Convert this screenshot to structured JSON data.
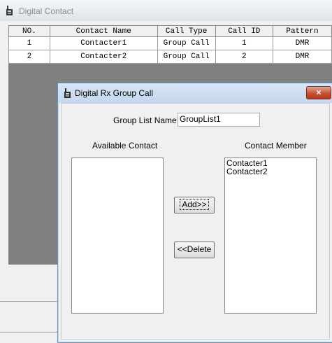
{
  "background_window": {
    "title": "Digital Contact",
    "icon": "radio-icon",
    "table": {
      "columns": [
        "NO.",
        "Contact Name",
        "Call Type",
        "Call ID",
        "Pattern"
      ],
      "rows": [
        [
          "1",
          "Contacter1",
          "Group Call",
          "1",
          "DMR"
        ],
        [
          "2",
          "Contacter2",
          "Group Call",
          "2",
          "DMR"
        ]
      ]
    }
  },
  "dialog": {
    "title": "Digital Rx Group Call",
    "icon": "radio-icon",
    "close_label": "×",
    "group_list_name_label": "Group List Name",
    "group_list_name_value": "GroupList1",
    "available_contact_label": "Available Contact",
    "available_contact_items": [],
    "contact_member_label": "Contact Member",
    "contact_member_items": [
      "Contacter1",
      "Contacter2"
    ],
    "add_button": "Add>>",
    "delete_button": "<<Delete"
  }
}
